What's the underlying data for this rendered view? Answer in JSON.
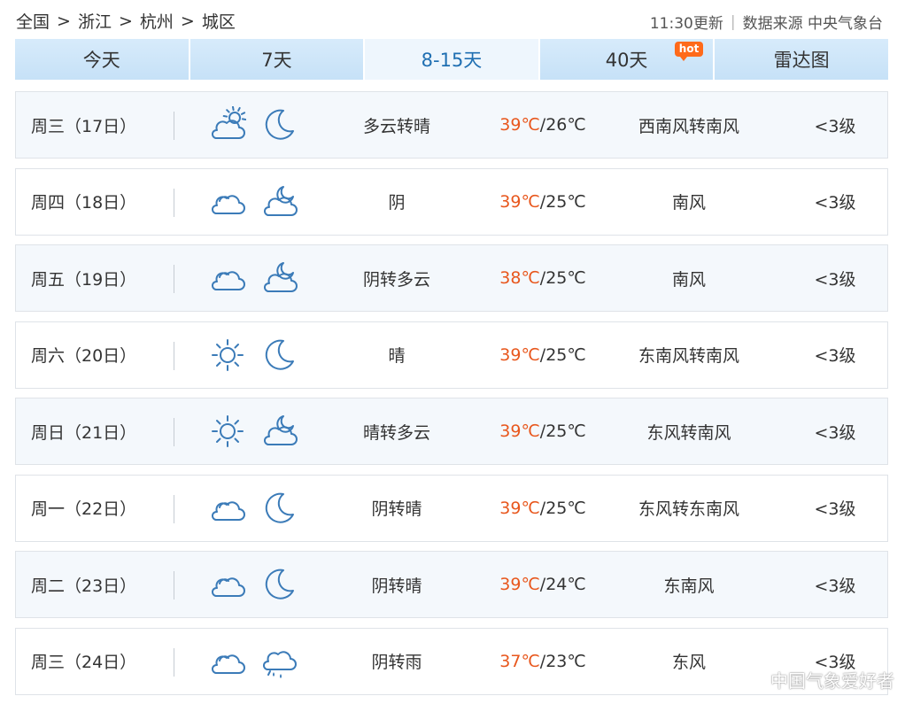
{
  "breadcrumb": {
    "items": [
      "全国",
      "浙江",
      "杭州",
      "城区"
    ],
    "separator": ">"
  },
  "update": {
    "time_label": "11:30更新",
    "divider": "|",
    "source_label": "数据来源 中央气象台"
  },
  "tabs": [
    {
      "label": "今天",
      "active": false
    },
    {
      "label": "7天",
      "active": false
    },
    {
      "label": "8-15天",
      "active": true
    },
    {
      "label": "40天",
      "active": false,
      "badge": "hot"
    },
    {
      "label": "雷达图",
      "active": false
    }
  ],
  "forecast": [
    {
      "day": "周三（17日）",
      "day_icon": "partly-cloudy-icon",
      "night_icon": "moon-icon",
      "desc": "多云转晴",
      "high": "39℃",
      "low": "/26℃",
      "wind": "西南风转南风",
      "level": "<3级"
    },
    {
      "day": "周四（18日）",
      "day_icon": "cloudy-icon",
      "night_icon": "cloudy-night-icon",
      "desc": "阴",
      "high": "39℃",
      "low": "/25℃",
      "wind": "南风",
      "level": "<3级"
    },
    {
      "day": "周五（19日）",
      "day_icon": "cloudy-icon",
      "night_icon": "cloudy-night-icon",
      "desc": "阴转多云",
      "high": "38℃",
      "low": "/25℃",
      "wind": "南风",
      "level": "<3级"
    },
    {
      "day": "周六（20日）",
      "day_icon": "sun-icon",
      "night_icon": "moon-icon",
      "desc": "晴",
      "high": "39℃",
      "low": "/25℃",
      "wind": "东南风转南风",
      "level": "<3级"
    },
    {
      "day": "周日（21日）",
      "day_icon": "sun-icon",
      "night_icon": "cloudy-night-icon",
      "desc": "晴转多云",
      "high": "39℃",
      "low": "/25℃",
      "wind": "东风转南风",
      "level": "<3级"
    },
    {
      "day": "周一（22日）",
      "day_icon": "cloudy-icon",
      "night_icon": "moon-icon",
      "desc": "阴转晴",
      "high": "39℃",
      "low": "/25℃",
      "wind": "东风转东南风",
      "level": "<3级"
    },
    {
      "day": "周二（23日）",
      "day_icon": "cloudy-icon",
      "night_icon": "moon-icon",
      "desc": "阴转晴",
      "high": "39℃",
      "low": "/24℃",
      "wind": "东南风",
      "level": "<3级"
    },
    {
      "day": "周三（24日）",
      "day_icon": "cloudy-icon",
      "night_icon": "rain-icon",
      "desc": "阴转雨",
      "high": "37℃",
      "low": "/23℃",
      "wind": "东风",
      "level": "<3级"
    }
  ],
  "colors": {
    "accent": "#1f6fb2",
    "high_temp": "#e8571d",
    "icon_stroke": "#3b7bb8"
  },
  "watermark": "中国气象爱好者"
}
